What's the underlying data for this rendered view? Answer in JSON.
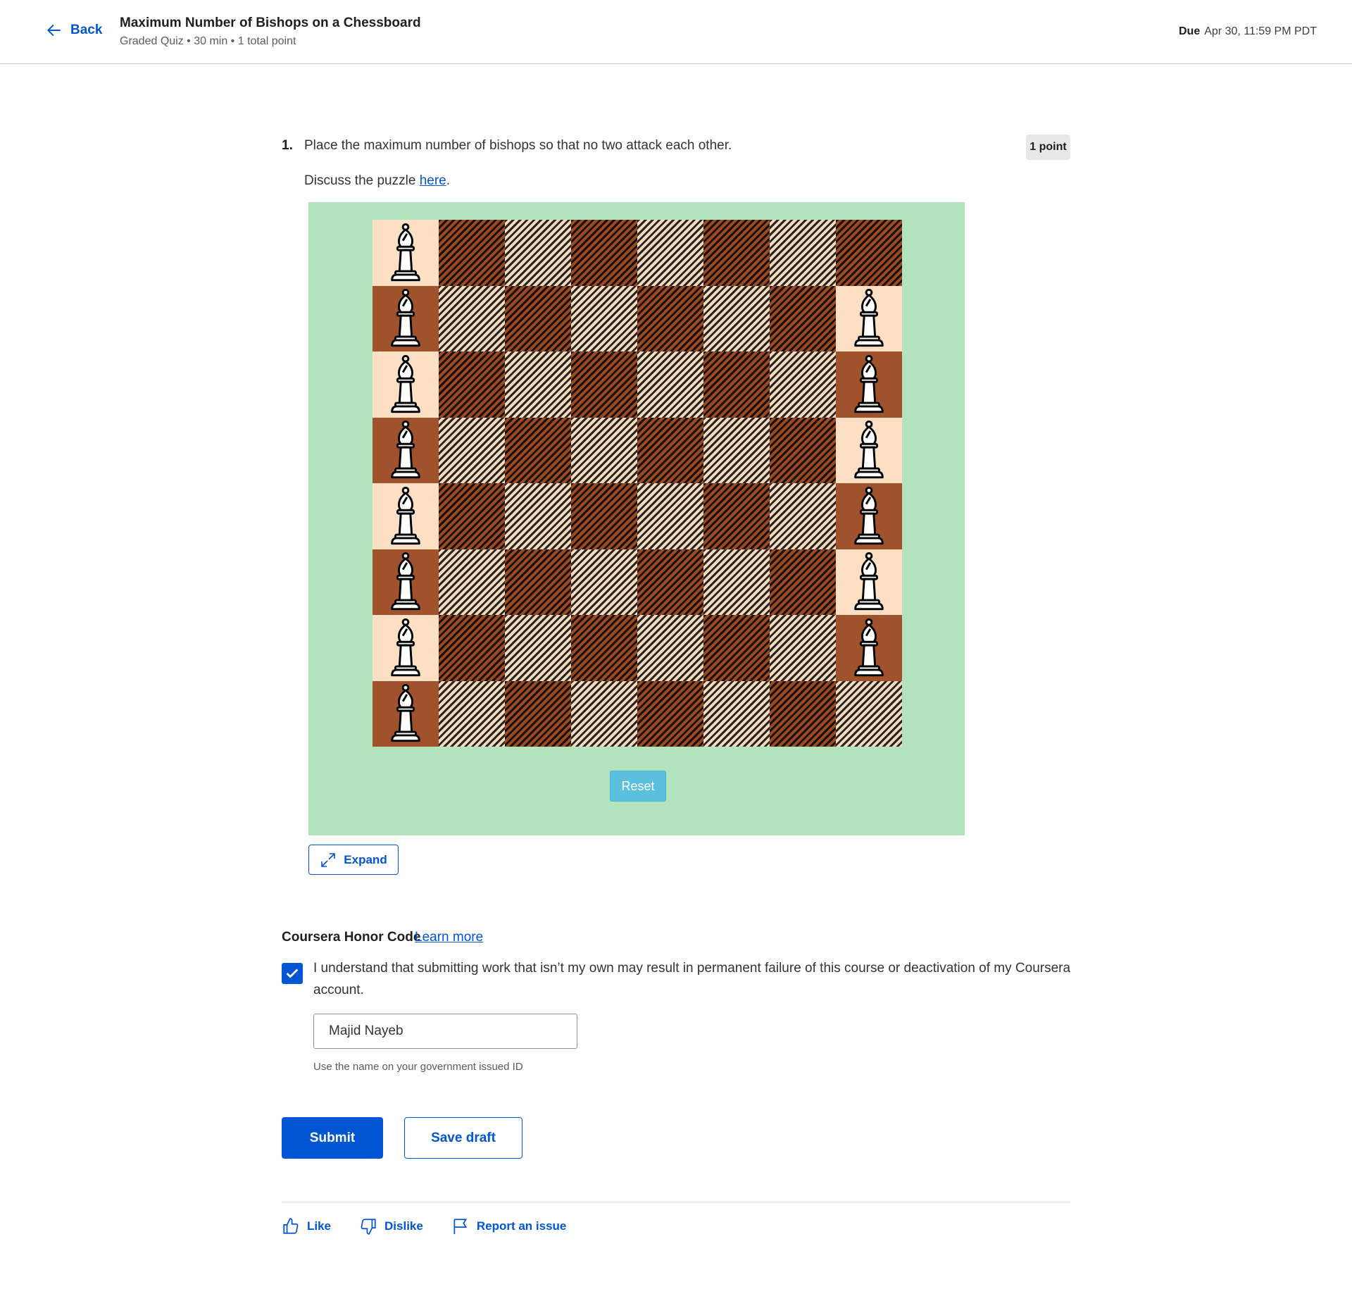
{
  "header": {
    "back_label": "Back",
    "title": "Maximum Number of Bishops on a Chessboard",
    "meta": "Graded Quiz • 30 min • 1 total point",
    "due_label": "Due",
    "due_value": "Apr 30, 11:59 PM PDT"
  },
  "question": {
    "number": "1.",
    "text": "Place the maximum number of bishops so that no two  attack each other.",
    "points": "1 point",
    "discuss_prefix": "Discuss the puzzle ",
    "discuss_link": "here",
    "discuss_suffix": "."
  },
  "puzzle": {
    "board_size": 8,
    "bishops": [
      [
        0,
        0
      ],
      [
        1,
        0
      ],
      [
        2,
        0
      ],
      [
        3,
        0
      ],
      [
        4,
        0
      ],
      [
        5,
        0
      ],
      [
        6,
        0
      ],
      [
        7,
        0
      ],
      [
        1,
        7
      ],
      [
        2,
        7
      ],
      [
        3,
        7
      ],
      [
        4,
        7
      ],
      [
        5,
        7
      ],
      [
        6,
        7
      ]
    ],
    "reset_label": "Reset",
    "colors": {
      "background": "#b3e3bd",
      "light": "#fde0c3",
      "dark": "#a0522d"
    }
  },
  "expand_label": "Expand",
  "honor": {
    "title": "Coursera Honor Code",
    "learn_more": "Learn more",
    "checked": true,
    "text": "I understand that submitting work that isn’t my own may result in permanent failure of this course or deactivation of my Coursera account.",
    "name_value": "Majid Nayeb",
    "hint": "Use the name on your government issued ID"
  },
  "actions": {
    "submit": "Submit",
    "save_draft": "Save draft"
  },
  "footer": {
    "like": "Like",
    "dislike": "Dislike",
    "report": "Report an issue"
  },
  "theme": {
    "accent": "#0056d2"
  }
}
